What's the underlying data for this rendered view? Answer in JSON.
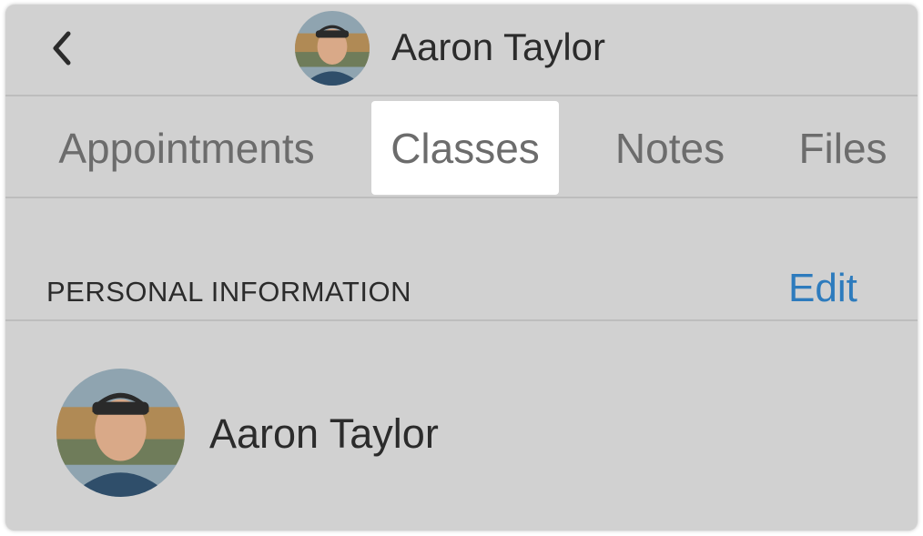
{
  "header": {
    "back_icon": "chevron-left-icon",
    "title": "Aaron Taylor"
  },
  "tabs": [
    {
      "label": "Appointments",
      "active": false
    },
    {
      "label": "Classes",
      "active": true
    },
    {
      "label": "Notes",
      "active": false
    },
    {
      "label": "Files",
      "active": false
    }
  ],
  "section": {
    "title": "PERSONAL INFORMATION",
    "edit_label": "Edit"
  },
  "profile": {
    "name": "Aaron Taylor"
  },
  "colors": {
    "accent": "#2d7bbd",
    "background": "#d1d1d1",
    "active_tab": "#ffffff"
  }
}
